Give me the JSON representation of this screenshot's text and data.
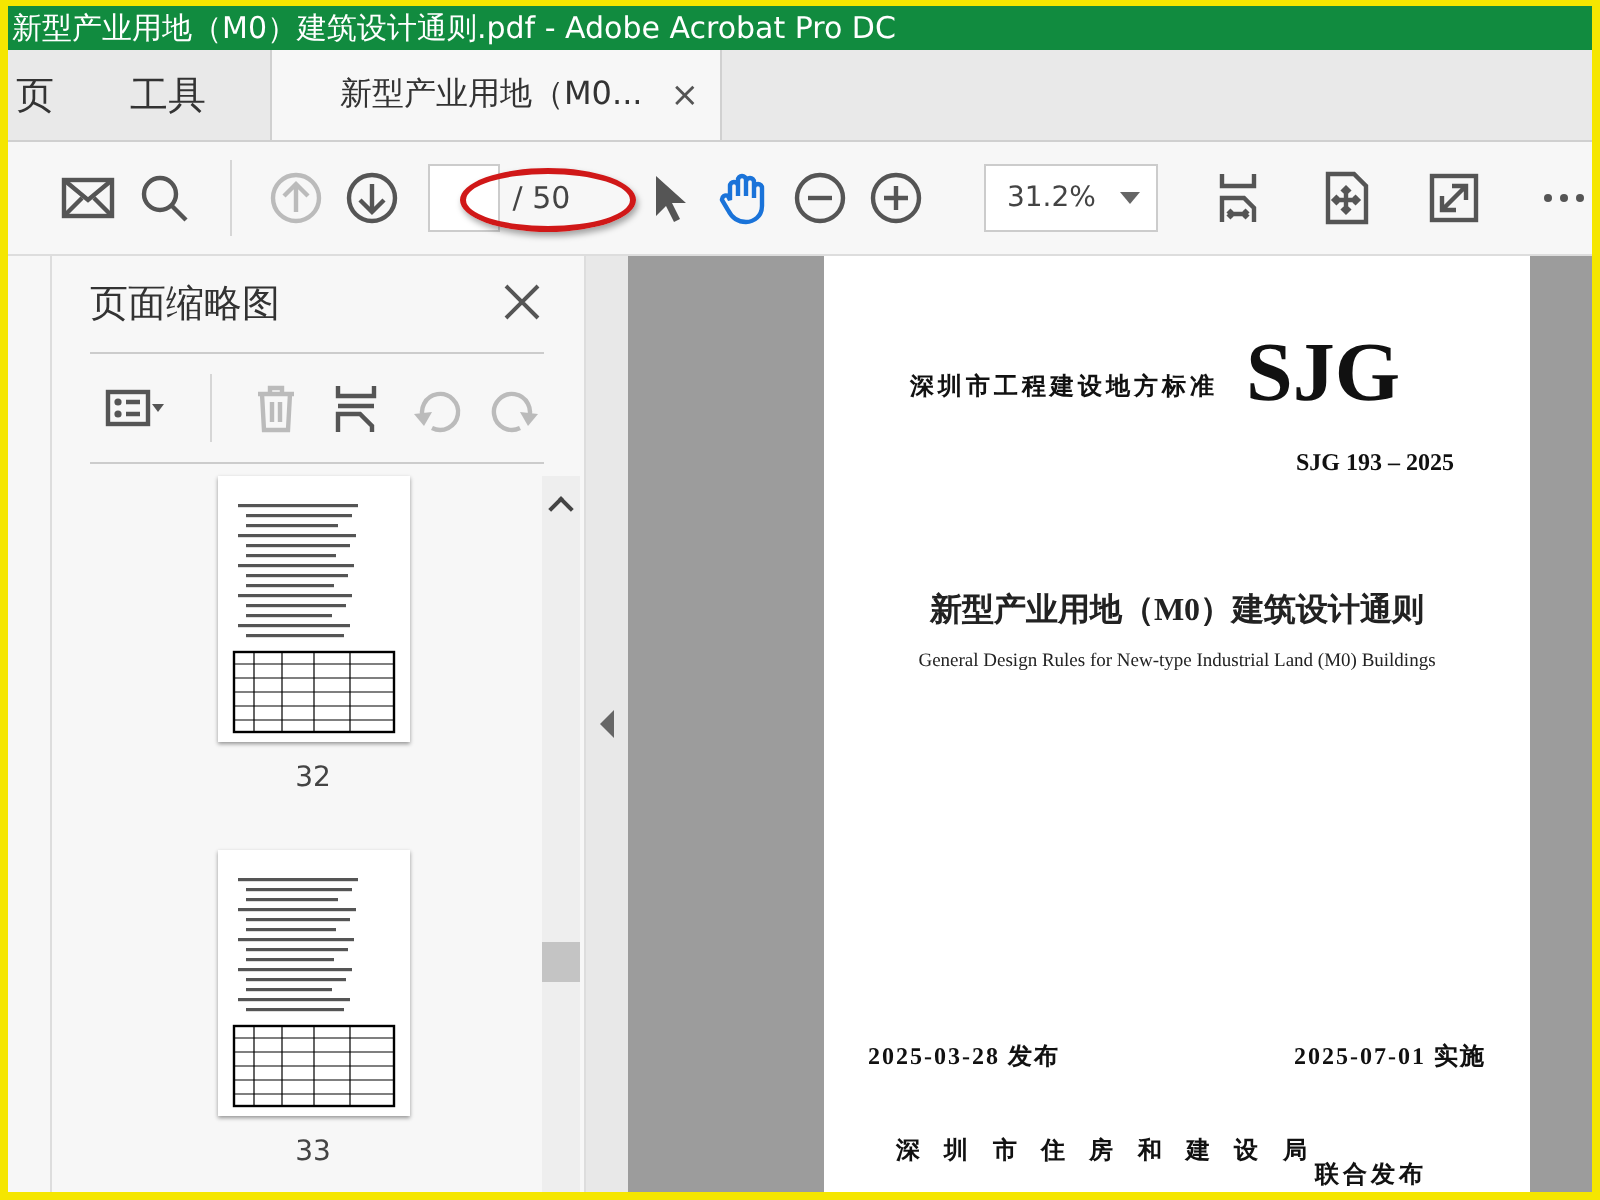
{
  "window": {
    "title": "新型产业用地（M0）建筑设计通则.pdf - Adobe Acrobat Pro DC"
  },
  "tabs": [
    {
      "label": "页",
      "selected": false
    },
    {
      "label": "工具",
      "selected": false
    },
    {
      "label": "新型产业用地（M0...",
      "selected": true,
      "close": "×"
    }
  ],
  "toolbar": {
    "left_tools": [
      {
        "kind": "mail"
      },
      {
        "kind": "search"
      }
    ],
    "nav_tools": [
      {
        "kind": "up",
        "disabled": true
      },
      {
        "kind": "down",
        "disabled": false
      }
    ],
    "page_field": {
      "total": "/ 50",
      "highlighted": true
    },
    "view_tools": [
      {
        "kind": "pointer",
        "selected": false
      },
      {
        "kind": "hand",
        "selected": true
      },
      {
        "kind": "zoom-out",
        "selected": false
      },
      {
        "kind": "zoom-in",
        "selected": false
      }
    ],
    "zoom": {
      "value": "31.2%"
    },
    "right_tools": [
      {
        "kind": "fit"
      },
      {
        "kind": "page-move"
      },
      {
        "kind": "expand"
      },
      {
        "kind": "more"
      }
    ]
  },
  "sidebar": {
    "title": "页面缩略图",
    "tools": [
      {
        "kind": "options",
        "disabled": false
      },
      {
        "kind": "delete",
        "disabled": true
      },
      {
        "kind": "insert",
        "disabled": false
      },
      {
        "kind": "rotate-left",
        "disabled": true
      },
      {
        "kind": "rotate-right",
        "disabled": true
      }
    ],
    "thumbnails": [
      {
        "label": "32"
      },
      {
        "label": "33"
      }
    ]
  },
  "document": {
    "issuer_type": "深圳市工程建设地方标准",
    "logo": "SJG",
    "code": "SJG 193 – 2025",
    "title": "新型产业用地（M0）建筑设计通则",
    "subtitle": "General Design Rules for New-type Industrial Land (M0) Buildings",
    "release_date": "2025-03-28 发布",
    "effective_date": "2025-07-01 实施",
    "publisher": "深 圳 市 住 房 和 建 设 局",
    "joint_release": "联合发布"
  }
}
